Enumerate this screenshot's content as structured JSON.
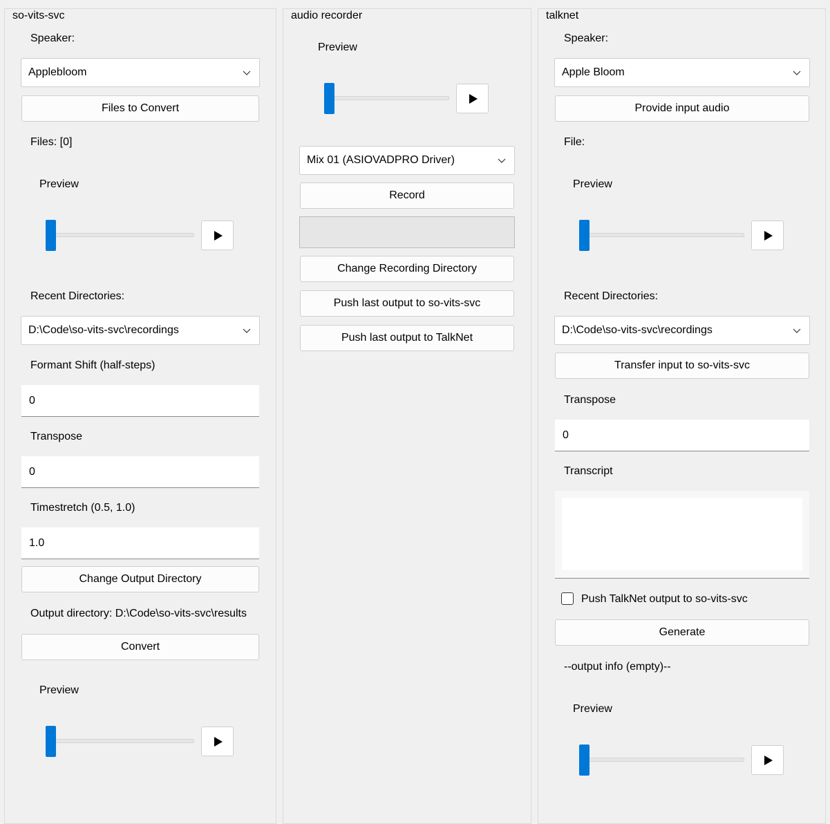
{
  "left": {
    "title": "so-vits-svc",
    "speaker_label": "Speaker:",
    "speaker_value": "Applebloom",
    "files_button": "Files to Convert",
    "files_status": "Files: [0]",
    "preview_label": "Preview",
    "recent_label": "Recent Directories:",
    "recent_value": "D:\\Code\\so-vits-svc\\recordings",
    "formant_label": "Formant Shift (half-steps)",
    "formant_value": "0",
    "transpose_label": "Transpose",
    "transpose_value": "0",
    "timestretch_label": "Timestretch (0.5, 1.0)",
    "timestretch_value": "1.0",
    "output_dir_button": "Change Output Directory",
    "output_dir_text": "Output directory: D:\\Code\\so-vits-svc\\results",
    "convert_button": "Convert",
    "preview2_label": "Preview"
  },
  "middle": {
    "title": "audio recorder",
    "preview_label": "Preview",
    "device_value": "Mix 01 (ASIOVADPRO Driver)",
    "record_button": "Record",
    "change_dir_button": "Change Recording Directory",
    "push_svc_button": "Push last output to so-vits-svc",
    "push_talknet_button": "Push last output to TalkNet"
  },
  "right": {
    "title": "talknet",
    "speaker_label": "Speaker:",
    "speaker_value": "Apple Bloom",
    "input_button": "Provide input audio",
    "file_label": "File:",
    "preview_label": "Preview",
    "recent_label": "Recent Directories:",
    "recent_value": "D:\\Code\\so-vits-svc\\recordings",
    "transfer_button": "Transfer input to so-vits-svc",
    "transpose_label": "Transpose",
    "transpose_value": "0",
    "transcript_label": "Transcript",
    "push_checkbox_label": "Push TalkNet output to so-vits-svc",
    "push_checkbox_checked": false,
    "generate_button": "Generate",
    "output_info": "--output info (empty)--",
    "preview2_label": "Preview"
  },
  "sliders": {
    "position": 0
  },
  "colors": {
    "accent": "#0078d7",
    "background": "#f0f0f0"
  },
  "icons": {
    "play": "play-icon",
    "dropdown": "chevron-down-icon"
  }
}
